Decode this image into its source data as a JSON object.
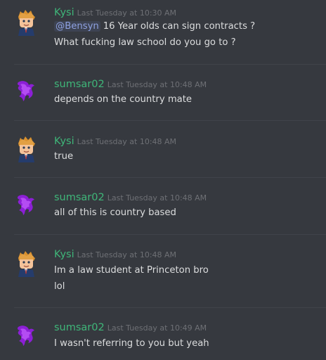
{
  "messages": [
    {
      "username": "Kysi",
      "timestamp": "Last Tuesday at 10:30 AM",
      "avatar": "kysi-avatar",
      "mention": "@Bensyn",
      "lines": [
        "16 Year olds can sign contracts ?",
        "What fucking law school do you go to ?"
      ]
    },
    {
      "username": "sumsar02",
      "timestamp": "Last Tuesday at 10:48 AM",
      "avatar": "sumsar-avatar",
      "lines": [
        "depends on the country mate"
      ]
    },
    {
      "username": "Kysi",
      "timestamp": "Last Tuesday at 10:48 AM",
      "avatar": "kysi-avatar",
      "lines": [
        "true"
      ]
    },
    {
      "username": "sumsar02",
      "timestamp": "Last Tuesday at 10:48 AM",
      "avatar": "sumsar-avatar",
      "lines": [
        "all of this is country based"
      ]
    },
    {
      "username": "Kysi",
      "timestamp": "Last Tuesday at 10:48 AM",
      "avatar": "kysi-avatar",
      "lines": [
        "Im a law student at Princeton bro",
        "lol"
      ]
    },
    {
      "username": "sumsar02",
      "timestamp": "Last Tuesday at 10:49 AM",
      "avatar": "sumsar-avatar",
      "lines": [
        "I wasn't referring to you but yeah"
      ]
    }
  ],
  "colors": {
    "background": "#36393f",
    "username": "#3fb679",
    "timestamp": "#6e7075",
    "message_text": "#dcddde",
    "mention": "#8ea1e1",
    "divider": "#40434a"
  }
}
